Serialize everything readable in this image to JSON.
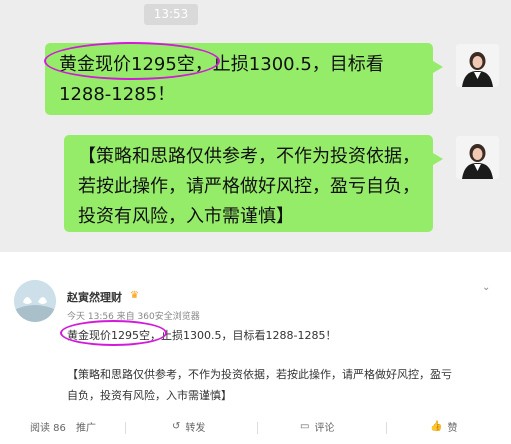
{
  "chat": {
    "time": "13:53",
    "messages": [
      {
        "text": "黄金现价1295空，止损1300.5，目标看1288-1285！"
      },
      {
        "text": "【策略和思路仅供参考，不作为投资依据，若按此操作，请严格做好风控，盈亏自负，投资有风险，入市需谨慎】"
      }
    ]
  },
  "post": {
    "author": "赵寅然理财",
    "meta": "今天 13:56 来自 360安全浏览器",
    "line1": "黄金现价1295空，止损1300.5，目标看1288-1285！",
    "line2": "【策略和思路仅供参考，不作为投资依据，若按此操作，请严格做好风控，盈亏",
    "line3": "自负，投资有风险，入市需谨慎】",
    "reads": "阅读 86",
    "promote": "推广",
    "repost": "转发",
    "comment": "评论",
    "like": "赞"
  },
  "colors": {
    "bubble": "#95ec69",
    "highlight": "#d21bd9",
    "chat_bg": "#ededed"
  },
  "icons": {
    "repost": "repost-icon",
    "comment": "comment-icon",
    "like": "like-icon",
    "more": "chevron-down-icon"
  }
}
